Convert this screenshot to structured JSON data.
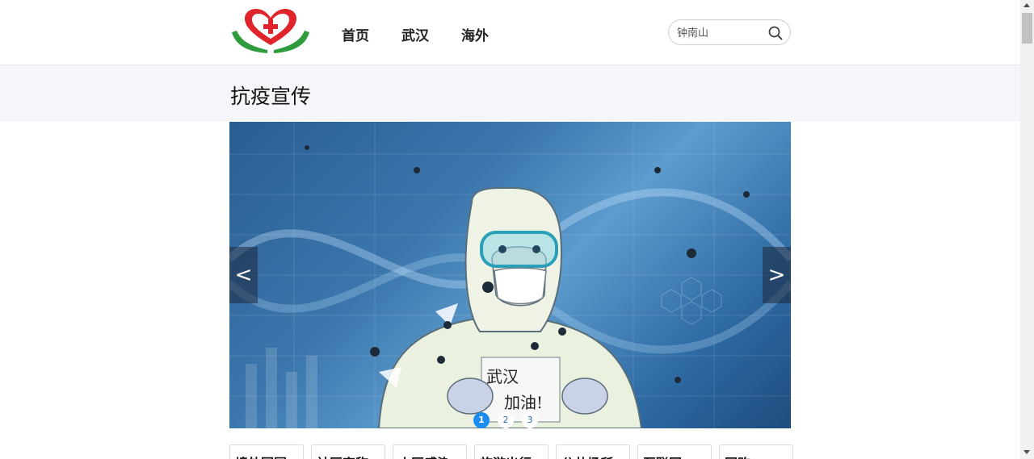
{
  "header": {
    "nav": [
      {
        "label": "首页"
      },
      {
        "label": "武汉"
      },
      {
        "label": "海外"
      }
    ],
    "search": {
      "placeholder": "钟南山",
      "icon": "search-icon"
    },
    "logo": {
      "icon": "heart-hands-logo",
      "colors": {
        "heart": "#e0242b",
        "hands": "#2e9b3c"
      }
    }
  },
  "section": {
    "title": "抗疫宣传"
  },
  "carousel": {
    "prev_label": "<",
    "next_label": ">",
    "slides": [
      {
        "label": "1",
        "active": true
      },
      {
        "label": "2",
        "active": false
      },
      {
        "label": "3",
        "active": false
      }
    ],
    "slide_sign_text": [
      "武汉",
      "加油!"
    ],
    "accent_color": "#1b8cf0"
  },
  "tiles": [
    {
      "label": "境外回国"
    },
    {
      "label": "社区宣称"
    },
    {
      "label": "小区感染"
    },
    {
      "label": "旅游出行"
    },
    {
      "label": "公共场所"
    },
    {
      "label": "互联网"
    },
    {
      "label": "网购"
    }
  ]
}
